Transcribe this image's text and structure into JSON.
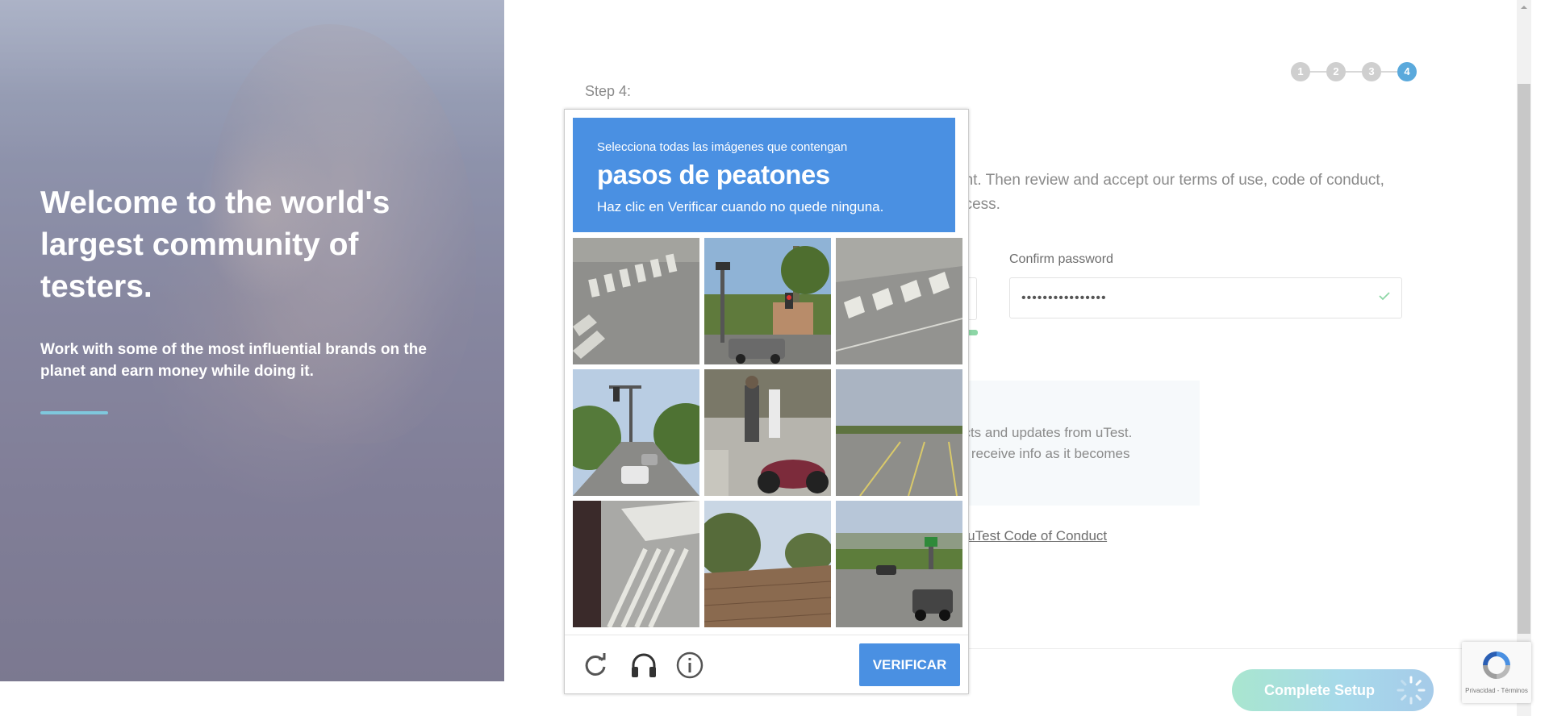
{
  "hero": {
    "title": "Welcome to the world's largest community of testers.",
    "subtitle": "Work with some of the most influential brands on the planet and earn money while doing it.",
    "accent_color": "#7fc8dd"
  },
  "form": {
    "step_label": "Step 4:",
    "steps": [
      "1",
      "2",
      "3",
      "4"
    ],
    "active_step": "4",
    "intro_line1": "unt. Then review and accept our terms of use, code of conduct,",
    "intro_line2": "ocess.",
    "confirm_password_label": "Confirm password",
    "confirm_password_value": "••••••••••••••••",
    "newsletter_line1": "ects and updates from uTest.",
    "newsletter_line2": "to receive info as it becomes",
    "conduct_link": "e uTest Code of Conduct",
    "complete_button": "Complete Setup"
  },
  "captcha": {
    "instruction": "Selecciona todas las imágenes que contengan",
    "target": "pasos de peatones",
    "hint": "Haz clic en Verificar cuando no quede ninguna.",
    "verify_button": "VERIFICAR",
    "header_color": "#4a90e2",
    "footer_icons": [
      "reload-icon",
      "audio-icon",
      "info-icon"
    ],
    "tiles": [
      "crosswalk-asphalt",
      "street-traffic-light-truck",
      "crosswalk-stripes",
      "road-with-cars",
      "sidewalk-motorcycle",
      "parking-lot",
      "crosswalk-closeup",
      "rooftop-trees",
      "road-with-truck"
    ]
  },
  "recaptcha_badge": {
    "terms": "Privacidad - Términos"
  }
}
